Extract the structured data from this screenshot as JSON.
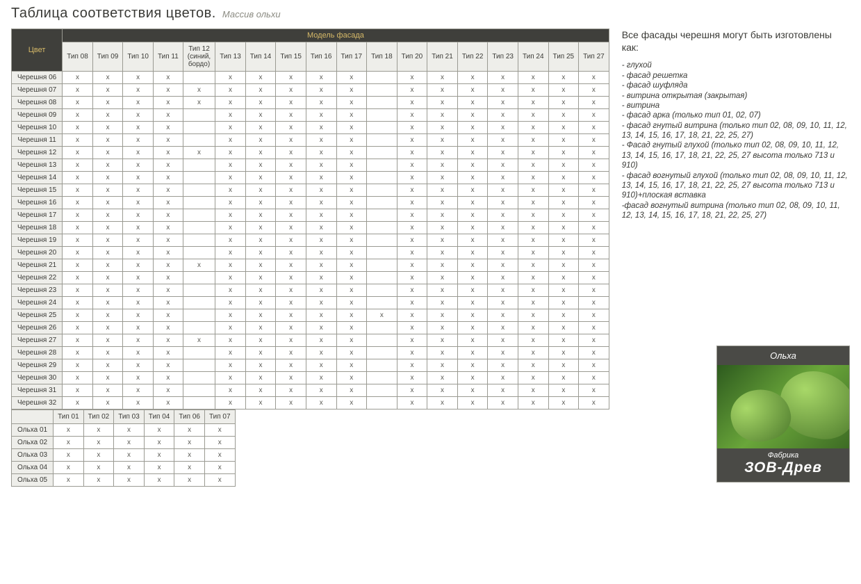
{
  "title": {
    "main": "Таблица соответствия цветов.",
    "sub": "Массив ольхи"
  },
  "table1": {
    "top_left": "Цвет",
    "top_right": "Модель фасада",
    "cols": [
      "Тип 08",
      "Тип 09",
      "Тип 10",
      "Тип 11",
      "Тип 12 (синий, бордо)",
      "Тип 13",
      "Тип 14",
      "Тип 15",
      "Тип 16",
      "Тип 17",
      "Тип 18",
      "Тип 20",
      "Тип 21",
      "Тип 22",
      "Тип 23",
      "Тип 24",
      "Тип 25",
      "Тип 27"
    ],
    "rows": [
      {
        "name": "Черешня 06",
        "cells": [
          "x",
          "x",
          "x",
          "x",
          "",
          "x",
          "x",
          "x",
          "x",
          "x",
          "",
          "x",
          "x",
          "x",
          "x",
          "x",
          "x",
          "x"
        ]
      },
      {
        "name": "Черешня 07",
        "cells": [
          "x",
          "x",
          "x",
          "x",
          "x",
          "x",
          "x",
          "x",
          "x",
          "x",
          "",
          "x",
          "x",
          "x",
          "x",
          "x",
          "x",
          "x"
        ]
      },
      {
        "name": "Черешня 08",
        "cells": [
          "x",
          "x",
          "x",
          "x",
          "x",
          "x",
          "x",
          "x",
          "x",
          "x",
          "",
          "x",
          "x",
          "x",
          "x",
          "x",
          "x",
          "x"
        ]
      },
      {
        "name": "Черешня 09",
        "cells": [
          "x",
          "x",
          "x",
          "x",
          "",
          "x",
          "x",
          "x",
          "x",
          "x",
          "",
          "x",
          "x",
          "x",
          "x",
          "x",
          "x",
          "x"
        ]
      },
      {
        "name": "Черешня 10",
        "cells": [
          "x",
          "x",
          "x",
          "x",
          "",
          "x",
          "x",
          "x",
          "x",
          "x",
          "",
          "x",
          "x",
          "x",
          "x",
          "x",
          "x",
          "x"
        ]
      },
      {
        "name": "Черешня 11",
        "cells": [
          "x",
          "x",
          "x",
          "x",
          "",
          "x",
          "x",
          "x",
          "x",
          "x",
          "",
          "x",
          "x",
          "x",
          "x",
          "x",
          "x",
          "x"
        ]
      },
      {
        "name": "Черешня 12",
        "cells": [
          "x",
          "x",
          "x",
          "x",
          "x",
          "x",
          "x",
          "x",
          "x",
          "x",
          "",
          "x",
          "x",
          "x",
          "x",
          "x",
          "x",
          "x"
        ]
      },
      {
        "name": "Черешня 13",
        "cells": [
          "x",
          "x",
          "x",
          "x",
          "",
          "x",
          "x",
          "x",
          "x",
          "x",
          "",
          "x",
          "x",
          "x",
          "x",
          "x",
          "x",
          "x"
        ]
      },
      {
        "name": "Черешня 14",
        "cells": [
          "x",
          "x",
          "x",
          "x",
          "",
          "x",
          "x",
          "x",
          "x",
          "x",
          "",
          "x",
          "x",
          "x",
          "x",
          "x",
          "x",
          "x"
        ]
      },
      {
        "name": "Черешня 15",
        "cells": [
          "x",
          "x",
          "x",
          "x",
          "",
          "x",
          "x",
          "x",
          "x",
          "x",
          "",
          "x",
          "x",
          "x",
          "x",
          "x",
          "x",
          "x"
        ]
      },
      {
        "name": "Черешня 16",
        "cells": [
          "x",
          "x",
          "x",
          "x",
          "",
          "x",
          "x",
          "x",
          "x",
          "x",
          "",
          "x",
          "x",
          "x",
          "x",
          "x",
          "x",
          "x"
        ]
      },
      {
        "name": "Черешня 17",
        "cells": [
          "x",
          "x",
          "x",
          "x",
          "",
          "x",
          "x",
          "x",
          "x",
          "x",
          "",
          "x",
          "x",
          "x",
          "x",
          "x",
          "x",
          "x"
        ]
      },
      {
        "name": "Черешня 18",
        "cells": [
          "x",
          "x",
          "x",
          "x",
          "",
          "x",
          "x",
          "x",
          "x",
          "x",
          "",
          "x",
          "x",
          "x",
          "x",
          "x",
          "x",
          "x"
        ]
      },
      {
        "name": "Черешня 19",
        "cells": [
          "x",
          "x",
          "x",
          "x",
          "",
          "x",
          "x",
          "x",
          "x",
          "x",
          "",
          "x",
          "x",
          "x",
          "x",
          "x",
          "x",
          "x"
        ]
      },
      {
        "name": "Черешня 20",
        "cells": [
          "x",
          "x",
          "x",
          "x",
          "",
          "x",
          "x",
          "x",
          "x",
          "x",
          "",
          "x",
          "x",
          "x",
          "x",
          "x",
          "x",
          "x"
        ]
      },
      {
        "name": "Черешня 21",
        "cells": [
          "x",
          "x",
          "x",
          "x",
          "x",
          "x",
          "x",
          "x",
          "x",
          "x",
          "",
          "x",
          "x",
          "x",
          "x",
          "x",
          "x",
          "x"
        ]
      },
      {
        "name": "Черешня 22",
        "cells": [
          "x",
          "x",
          "x",
          "x",
          "",
          "x",
          "x",
          "x",
          "x",
          "x",
          "",
          "x",
          "x",
          "x",
          "x",
          "x",
          "x",
          "x"
        ]
      },
      {
        "name": "Черешня 23",
        "cells": [
          "x",
          "x",
          "x",
          "x",
          "",
          "x",
          "x",
          "x",
          "x",
          "x",
          "",
          "x",
          "x",
          "x",
          "x",
          "x",
          "x",
          "x"
        ]
      },
      {
        "name": "Черешня 24",
        "cells": [
          "x",
          "x",
          "x",
          "x",
          "",
          "x",
          "x",
          "x",
          "x",
          "x",
          "",
          "x",
          "x",
          "x",
          "x",
          "x",
          "x",
          "x"
        ]
      },
      {
        "name": "Черешня 25",
        "cells": [
          "x",
          "x",
          "x",
          "x",
          "",
          "x",
          "x",
          "x",
          "x",
          "x",
          "x",
          "x",
          "x",
          "x",
          "x",
          "x",
          "x",
          "x"
        ]
      },
      {
        "name": "Черешня 26",
        "cells": [
          "x",
          "x",
          "x",
          "x",
          "",
          "x",
          "x",
          "x",
          "x",
          "x",
          "",
          "x",
          "x",
          "x",
          "x",
          "x",
          "x",
          "x"
        ]
      },
      {
        "name": "Черешня 27",
        "cells": [
          "x",
          "x",
          "x",
          "x",
          "x",
          "x",
          "x",
          "x",
          "x",
          "x",
          "",
          "x",
          "x",
          "x",
          "x",
          "x",
          "x",
          "x"
        ]
      },
      {
        "name": "Черешня 28",
        "cells": [
          "x",
          "x",
          "x",
          "x",
          "",
          "x",
          "x",
          "x",
          "x",
          "x",
          "",
          "x",
          "x",
          "x",
          "x",
          "x",
          "x",
          "x"
        ]
      },
      {
        "name": "Черешня 29",
        "cells": [
          "x",
          "x",
          "x",
          "x",
          "",
          "x",
          "x",
          "x",
          "x",
          "x",
          "",
          "x",
          "x",
          "x",
          "x",
          "x",
          "x",
          "x"
        ]
      },
      {
        "name": "Черешня 30",
        "cells": [
          "x",
          "x",
          "x",
          "x",
          "",
          "x",
          "x",
          "x",
          "x",
          "x",
          "",
          "x",
          "x",
          "x",
          "x",
          "x",
          "x",
          "x"
        ]
      },
      {
        "name": "Черешня 31",
        "cells": [
          "x",
          "x",
          "x",
          "x",
          "",
          "x",
          "x",
          "x",
          "x",
          "x",
          "",
          "x",
          "x",
          "x",
          "x",
          "x",
          "x",
          "x"
        ]
      },
      {
        "name": "Черешня 32",
        "cells": [
          "x",
          "x",
          "x",
          "x",
          "",
          "x",
          "x",
          "x",
          "x",
          "x",
          "",
          "x",
          "x",
          "x",
          "x",
          "x",
          "x",
          "x"
        ]
      }
    ]
  },
  "table2": {
    "cols": [
      "Тип 01",
      "Тип 02",
      "Тип 03",
      "Тип 04",
      "Тип 06",
      "Тип 07"
    ],
    "rows": [
      {
        "name": "Ольха 01",
        "cells": [
          "x",
          "x",
          "x",
          "x",
          "x",
          "x"
        ]
      },
      {
        "name": "Ольха 02",
        "cells": [
          "x",
          "x",
          "x",
          "x",
          "x",
          "x"
        ]
      },
      {
        "name": "Ольха 03",
        "cells": [
          "x",
          "x",
          "x",
          "x",
          "x",
          "x"
        ]
      },
      {
        "name": "Ольха 04",
        "cells": [
          "x",
          "x",
          "x",
          "x",
          "x",
          "x"
        ]
      },
      {
        "name": "Ольха 05",
        "cells": [
          "x",
          "x",
          "x",
          "x",
          "x",
          "x"
        ]
      }
    ]
  },
  "notes": {
    "title": "Все фасады черешня могут быть изготовлены как:",
    "items": [
      "- глухой",
      "- фасад решетка",
      "- фасад шуфляда",
      "- витрина открытая (закрытая)",
      "- витрина",
      "- фасад арка (только тип 01, 02, 07)",
      "- фасад гнутый витрина (только тип 02, 08, 09, 10, 11, 12, 13, 14, 15, 16, 17, 18, 21, 22, 25, 27)",
      "- Фасад гнутый глухой (только тип 02, 08, 09, 10, 11, 12, 13, 14, 15, 16, 17, 18, 21, 22, 25, 27 высота только 713 и 910)",
      "- фасад вогнутый глухой (только тип 02, 08, 09, 10, 11, 12, 13, 14, 15, 16, 17, 18, 21, 22, 25, 27 высота только 713 и 910)+плоская вставка",
      " -фасад вогнутый витрина (только тип 02, 08, 09, 10, 11, 12, 13, 14, 15, 16, 17, 18, 21, 22, 25, 27)"
    ]
  },
  "card": {
    "top": "Ольха",
    "bottom_sm": "Фабрика",
    "bottom_lg": "ЗОВ-Древ"
  }
}
